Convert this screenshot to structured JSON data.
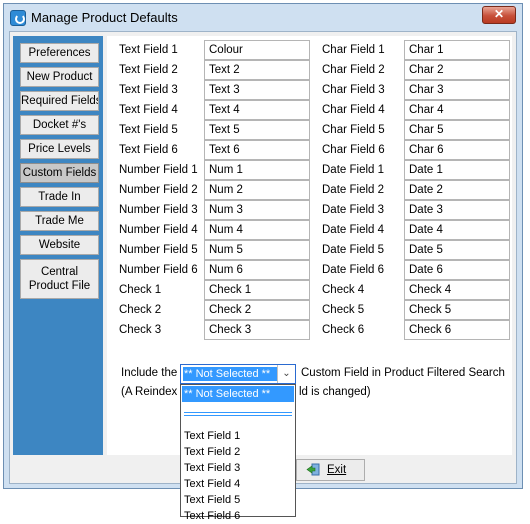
{
  "window": {
    "title": "Manage Product Defaults",
    "close_glyph": "✕"
  },
  "sidebar": {
    "items": [
      {
        "label": "Preferences",
        "active": false
      },
      {
        "label": "New Product",
        "active": false
      },
      {
        "label": "Required Fields",
        "active": false
      },
      {
        "label": "Docket #'s",
        "active": false
      },
      {
        "label": "Price Levels",
        "active": false
      },
      {
        "label": "Custom Fields",
        "active": true
      },
      {
        "label": "Trade In",
        "active": false
      },
      {
        "label": "Trade Me",
        "active": false
      },
      {
        "label": "Website",
        "active": false
      },
      {
        "label": "Central Product File",
        "active": false
      }
    ]
  },
  "left_fields": [
    {
      "label": "Text Field 1",
      "value": "Colour"
    },
    {
      "label": "Text Field 2",
      "value": "Text 2"
    },
    {
      "label": "Text Field 3",
      "value": "Text 3"
    },
    {
      "label": "Text Field 4",
      "value": "Text 4"
    },
    {
      "label": "Text Field 5",
      "value": "Text 5"
    },
    {
      "label": "Text Field 6",
      "value": "Text 6"
    },
    {
      "label": "Number Field 1",
      "value": "Num 1"
    },
    {
      "label": "Number Field 2",
      "value": "Num 2"
    },
    {
      "label": "Number Field 3",
      "value": "Num 3"
    },
    {
      "label": "Number Field 4",
      "value": "Num 4"
    },
    {
      "label": "Number Field 5",
      "value": "Num 5"
    },
    {
      "label": "Number Field 6",
      "value": "Num 6"
    },
    {
      "label": "Check 1",
      "value": "Check 1"
    },
    {
      "label": "Check 2",
      "value": "Check 2"
    },
    {
      "label": "Check 3",
      "value": "Check 3"
    }
  ],
  "right_fields": [
    {
      "label": "Char Field 1",
      "value": "Char 1"
    },
    {
      "label": "Char Field 2",
      "value": "Char 2"
    },
    {
      "label": "Char Field 3",
      "value": "Char 3"
    },
    {
      "label": "Char Field 4",
      "value": "Char 4"
    },
    {
      "label": "Char Field 5",
      "value": "Char 5"
    },
    {
      "label": "Char Field 6",
      "value": "Char 6"
    },
    {
      "label": "Date Field 1",
      "value": "Date 1"
    },
    {
      "label": "Date Field 2",
      "value": "Date 2"
    },
    {
      "label": "Date Field 3",
      "value": "Date 3"
    },
    {
      "label": "Date Field 4",
      "value": "Date 4"
    },
    {
      "label": "Date Field 5",
      "value": "Date 5"
    },
    {
      "label": "Date Field 6",
      "value": "Date 6"
    },
    {
      "label": "Check 4",
      "value": "Check 4"
    },
    {
      "label": "Check 5",
      "value": "Check 5"
    },
    {
      "label": "Check 6",
      "value": "Check 6"
    }
  ],
  "search_filter": {
    "prefix": "Include the",
    "selected": "** Not Selected **",
    "suffix": "Custom Field in Product Filtered Search",
    "note_start": "(A Reindex",
    "note_end": "ld is changed)",
    "options": [
      "** Not Selected **",
      "",
      "Text Field 1",
      "Text Field 2",
      "Text Field 3",
      "Text Field 4",
      "Text Field 5",
      "Text Field 6"
    ]
  },
  "footer": {
    "exit_label": "Exit"
  }
}
